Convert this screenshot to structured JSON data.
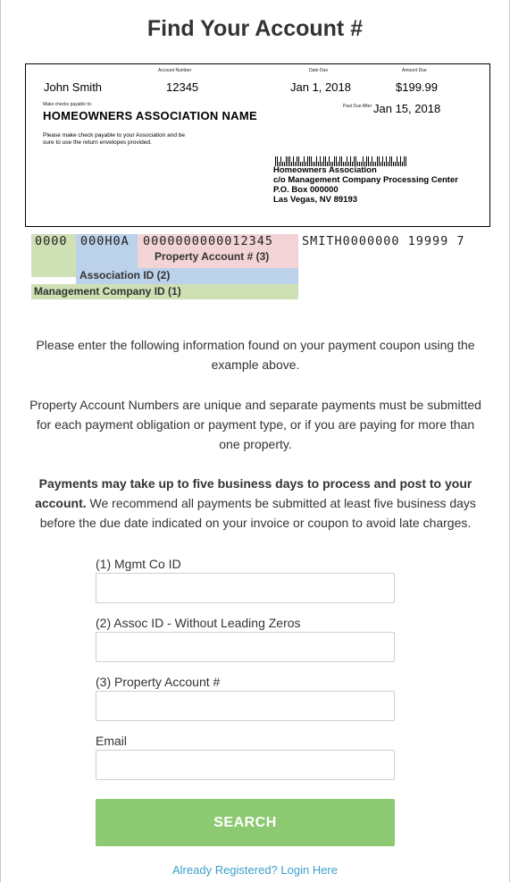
{
  "page": {
    "title": "Find Your Account #"
  },
  "coupon": {
    "name": "John Smith",
    "account_label": "Account Number",
    "account_number": "12345",
    "due_label": "Date Due",
    "due_date": "Jan 1, 2018",
    "amount_label": "Amount Due",
    "amount": "$199.99",
    "payable_label": "Make checks payable to:",
    "hoa_name": "HOMEOWNERS  ASSOCIATION NAME",
    "past_due_label": "Past Due After",
    "past_due_date": "Jan 15, 2018",
    "note_line1": "Please make check payable to your Association and be",
    "note_line2": "sure to use the return envelopes  provided.",
    "address": [
      "Homeowners Association",
      "c/o Management Company Processing Center",
      "P.O. Box 000000",
      "Las Vegas, NV 89193"
    ]
  },
  "micr": {
    "mgmt": "0000",
    "assoc": "000H0A",
    "property": "0000000000012345",
    "rest": "SMITH0000000 19999 7",
    "property_label": "Property Account # (3)",
    "assoc_label": "Association ID (2)",
    "mgmt_label": "Management Company ID (1)"
  },
  "instructions": {
    "p1": "Please enter the following information found on your payment coupon using the example above.",
    "p2": "Property Account Numbers are unique and separate payments must be submitted for each payment obligation or payment type, or if you are paying for more than one property.",
    "p3_bold": "Payments may take up to five business days to process and post to your account.",
    "p3_rest": " We recommend all payments be submitted at least five business days before the due date indicated on your invoice or coupon to avoid late charges."
  },
  "form": {
    "mgmt_label": "(1) Mgmt Co ID",
    "mgmt_value": "",
    "assoc_label": "(2) Assoc ID - Without Leading Zeros",
    "assoc_value": "",
    "property_label": "(3) Property Account #",
    "property_value": "",
    "email_label": "Email",
    "email_value": "",
    "search_label": "SEARCH",
    "login_link": "Already Registered? Login Here"
  },
  "colors": {
    "search_button": "#8cc970",
    "link": "#3aa0c8",
    "mgmt_highlight": "#cfe0b5",
    "assoc_highlight": "#bcd1ea",
    "property_highlight": "#f2d3d6"
  }
}
